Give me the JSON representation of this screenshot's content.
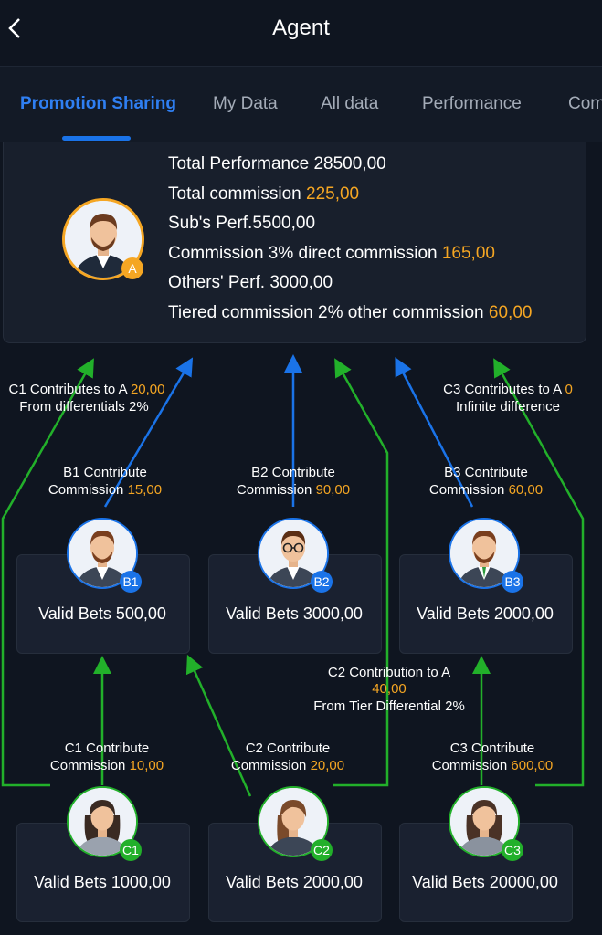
{
  "header": {
    "title": "Agent"
  },
  "tabs": [
    {
      "label": "Promotion Sharing"
    },
    {
      "label": "My Data"
    },
    {
      "label": "All data"
    },
    {
      "label": "Performance"
    },
    {
      "label": "Com"
    }
  ],
  "summary": {
    "total_performance": "Total Performance 28500,00",
    "total_commission_label": "Total commission",
    "total_commission_value": "225,00",
    "subs_perf": "Sub's Perf.5500,00",
    "direct_label": "Commission 3% direct commission",
    "direct_value": "165,00",
    "others_perf": "Others' Perf. 3000,00",
    "tiered_label": "Tiered commission 2% other commission",
    "tiered_value": "60,00",
    "badge": "A"
  },
  "notes": {
    "c1_to_a_label": "C1 Contributes to A",
    "c1_to_a_value": "20,00",
    "c1_to_a_sub": "From differentials 2%",
    "c3_to_a_label": "C3 Contributes to A",
    "c3_to_a_value": "0",
    "c3_to_a_sub": "Infinite difference",
    "c2_to_a_label": "C2 Contribution to A",
    "c2_to_a_value": "40,00",
    "c2_to_a_sub": "From Tier Differential 2%"
  },
  "tier_b": [
    {
      "badge": "B1",
      "contrib_title": "B1 Contribute",
      "commission_label": "Commission",
      "commission_value": "15,00",
      "bets": "Valid Bets 500,00"
    },
    {
      "badge": "B2",
      "contrib_title": "B2 Contribute",
      "commission_label": "Commission",
      "commission_value": "90,00",
      "bets": "Valid Bets 3000,00"
    },
    {
      "badge": "B3",
      "contrib_title": "B3 Contribute",
      "commission_label": "Commission",
      "commission_value": "60,00",
      "bets": "Valid Bets 2000,00"
    }
  ],
  "tier_c": [
    {
      "badge": "C1",
      "contrib_title": "C1 Contribute",
      "commission_label": "Commission",
      "commission_value": "10,00",
      "bets": "Valid Bets 1000,00"
    },
    {
      "badge": "C2",
      "contrib_title": "C2 Contribute",
      "commission_label": "Commission",
      "commission_value": "20,00",
      "bets": "Valid Bets 2000,00"
    },
    {
      "badge": "C3",
      "contrib_title": "C3 Contribute",
      "commission_label": "Commission",
      "commission_value": "600,00",
      "bets": "Valid Bets 20000,00"
    }
  ],
  "colors": {
    "background": "#0f1520",
    "accent_tab": "#2f7ff2",
    "highlight": "#f5a623",
    "blue_arrow": "#1a73e8",
    "green_arrow": "#22b02a"
  }
}
